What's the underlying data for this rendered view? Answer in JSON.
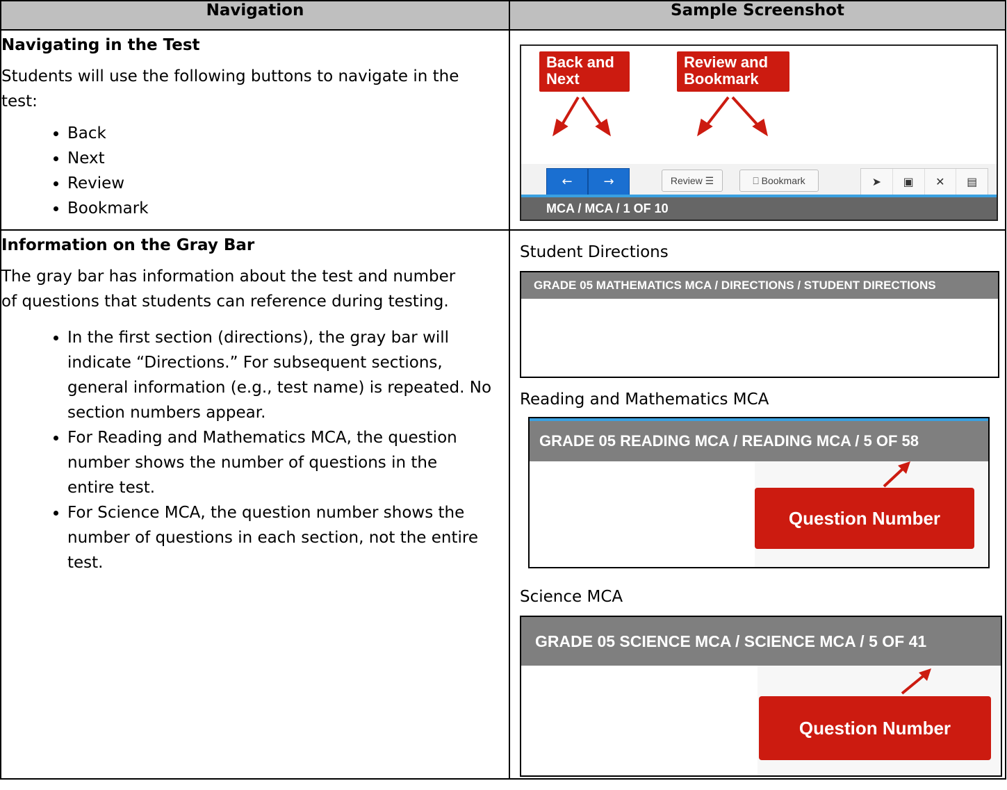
{
  "table": {
    "col_navigation": "Navigation",
    "col_screenshot": "Sample Screenshot"
  },
  "row1": {
    "heading": "Navigating in the Test",
    "intro": "Students will use the following buttons to navigate in the test:",
    "buttons": [
      "Back",
      "Next",
      "Review",
      "Bookmark"
    ],
    "shot": {
      "callout_back_next": "Back and Next",
      "callout_review_bookmark": "Review and Bookmark",
      "back_arrow": "←",
      "next_arrow": "→",
      "review_label": "Review ☰",
      "bookmark_label": "⎕ Bookmark",
      "tool_icons": [
        "pointer-icon",
        "notepad-icon",
        "strikethrough-icon",
        "calculator-icon"
      ],
      "tool_glyphs": [
        "➤",
        "▣",
        "✕",
        "▤"
      ],
      "gray_bar": "MCA  /  MCA  /  1 OF 10"
    }
  },
  "row2": {
    "heading": "Information on the Gray Bar",
    "intro": "The gray bar has information about the test and number of questions that students can reference during testing.",
    "bullets": [
      "In the first section (directions), the gray bar will indicate “Directions.” For subsequent sections, general information (e.g., test name) is repeated. No section numbers appear.",
      "For Reading and Mathematics MCA, the question number shows the number of questions in the entire test.",
      "For Science MCA, the question number shows the number of questions in each section, not the entire test."
    ],
    "sample1_label": "Student Directions",
    "sample1_bar": "GRADE 05 MATHEMATICS MCA  /  DIRECTIONS  /  STUDENT DIRECTIONS",
    "sample2_label": "Reading and Mathematics MCA",
    "sample2_bar": "GRADE 05 READING MCA  /  READING MCA  /  5 OF 58",
    "sample2_callout": "Question Number",
    "sample3_label": "Science MCA",
    "sample3_bar": "GRADE 05 SCIENCE MCA  / SCIENCE MCA  / 5 OF 41",
    "sample3_callout": "Question Number"
  },
  "colors": {
    "header_gray": "#bfbfbf",
    "bar_gray": "#7f7f7f",
    "callout_red": "#cc1b10",
    "button_blue": "#1a6fd1"
  }
}
